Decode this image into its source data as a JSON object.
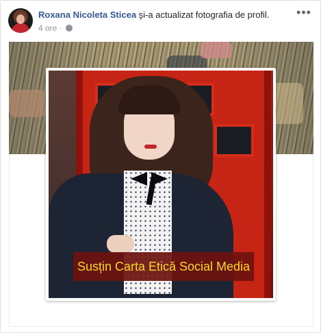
{
  "post": {
    "author_name": "Roxana Nicoleta Sticea",
    "action_text": " şi-a actualizat fotografia de profil.",
    "time": "4 ore",
    "separator": "·",
    "privacy_icon": "globe-icon",
    "more_icon": "ellipsis-icon",
    "more_glyph": "•••"
  },
  "profile_photo": {
    "banner_text": "Susțin Carta Etică Social Media",
    "banner_text_color": "#f6d928",
    "banner_bg_color": "#6e120e"
  },
  "colors": {
    "author_link": "#365899",
    "meta_text": "#90949c",
    "body_text": "#1d2129"
  }
}
